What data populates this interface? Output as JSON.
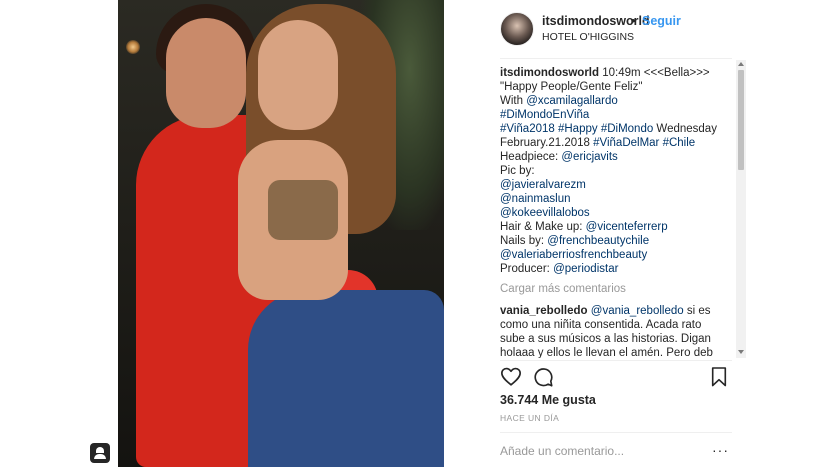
{
  "post": {
    "username": "itsdimondosworld",
    "bullet": "•",
    "follow_label": "Seguir",
    "location": "HOTEL O'HIGGINS"
  },
  "caption": {
    "lines": [
      [
        "itsdimondosworld",
        " 10:49m <<<Bella>>>"
      ],
      "\"Happy People/Gente Feliz\"",
      [
        "With ",
        "@xcamilagallardo"
      ],
      "#DiMondoEnViña",
      [
        "#Viña2018 #Happy #DiMondo",
        " Wednesday"
      ],
      [
        "February.21.2018 ",
        "#ViñaDelMar #Chile"
      ],
      [
        "Headpiece: ",
        "@ericjavits"
      ],
      "Pic by:",
      "@javieralvarezm",
      "@nainmaslun",
      "@kokeevillalobos",
      [
        "Hair & Make up: ",
        "@vicenteferrerp"
      ],
      [
        "Nails by: ",
        "@frenchbeautychile"
      ],
      "@valeriaberriosfrenchbeauty",
      [
        "Producer: ",
        "@periodistar"
      ]
    ]
  },
  "load_more": "Cargar más comentarios",
  "comment": {
    "username": "vania_rebolledo",
    "mention": "@vania_rebolledo",
    "line1_rest": " si es",
    "line2": "como una niñita consentida. Acada rato",
    "line3": "sube a sus músicos a las historias. Digan",
    "line4": "holaaa y ellos le llevan el amén. Pero deb"
  },
  "actions": {
    "like_icon": "heart-icon",
    "comment_icon": "comment-icon",
    "save_icon": "bookmark-icon"
  },
  "likes": "36.744 Me gusta",
  "time_ago": "HACE UN DÍA",
  "add_comment_placeholder": "Añade un comentario...",
  "more_options": "···"
}
